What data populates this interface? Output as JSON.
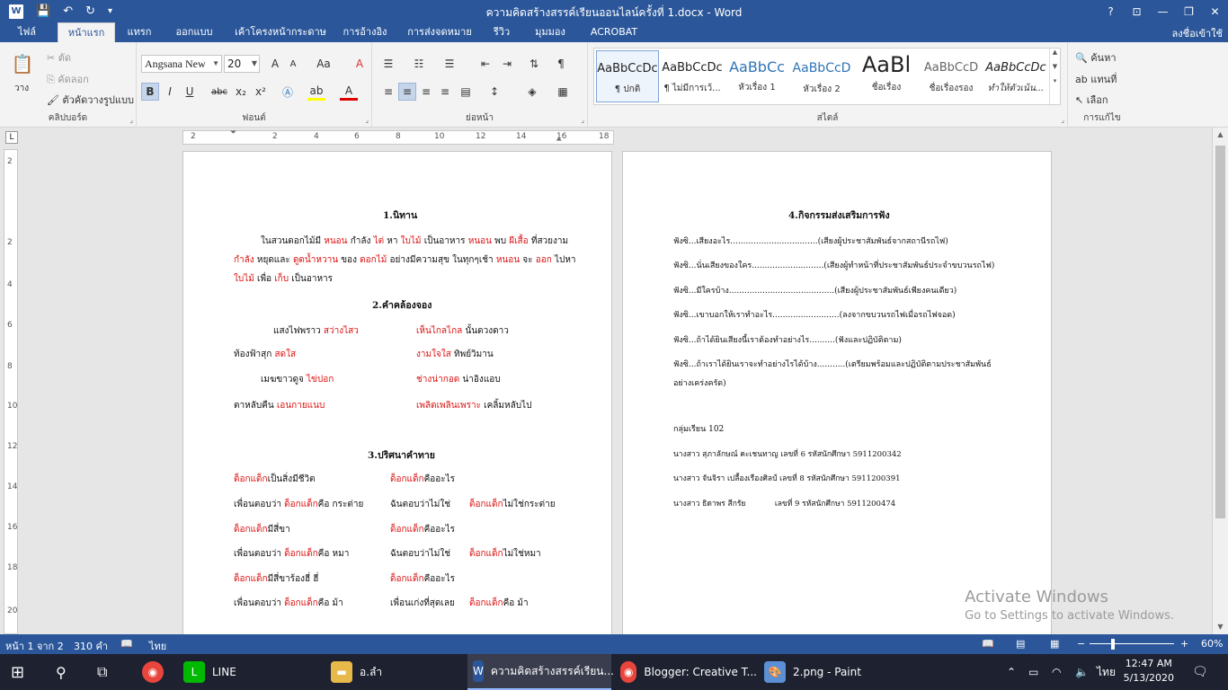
{
  "window": {
    "title": "ความคิดสร้างสรรค์เรียนออนไลน์ครั้งที่ 1.docx - Word",
    "help": "?",
    "controls": [
      "⊡",
      "—",
      "❐",
      "✕"
    ]
  },
  "qat": {
    "word_icon": "W",
    "save": "💾",
    "undo": "↶",
    "redo": "↻",
    "customize": "▾"
  },
  "tabs": {
    "file": "ไฟล์",
    "items": [
      "หน้าแรก",
      "แทรก",
      "ออกแบบ",
      "เค้าโครงหน้ากระดาษ",
      "การอ้างอิง",
      "การส่งจดหมาย",
      "รีวิว",
      "มุมมอง",
      "ACROBAT"
    ],
    "signin": "ลงชื่อเข้าใช้"
  },
  "ribbon": {
    "clipboard": {
      "label": "คลิปบอร์ด",
      "paste": "วาง",
      "cut": "ตัด",
      "copy": "คัดลอก",
      "format_painter": "ตัวคัดวางรูปแบบ"
    },
    "font": {
      "label": "ฟอนต์",
      "font_name": "Angsana New",
      "font_size": "20",
      "bold": "B",
      "italic": "I",
      "underline": "U",
      "strike": "abc",
      "subscript": "x₂",
      "superscript": "x²",
      "grow": "A",
      "shrink": "A",
      "case": "Aa",
      "clear": "A"
    },
    "paragraph": {
      "label": "ย่อหน้า"
    },
    "styles": {
      "label": "สไตล์",
      "items": [
        {
          "preview": "AaBbCcDc",
          "name": "¶ ปกติ"
        },
        {
          "preview": "AaBbCcDc",
          "name": "¶ ไม่มีการเว้..."
        },
        {
          "preview": "AaBbCc",
          "name": "หัวเรื่อง 1"
        },
        {
          "preview": "AaBbCcD",
          "name": "หัวเรื่อง 2"
        },
        {
          "preview": "AaBl",
          "name": "ชื่อเรื่อง"
        },
        {
          "preview": "AaBbCcD",
          "name": "ชื่อเรื่องรอง"
        },
        {
          "preview": "AaBbCcDc",
          "name": "ทำให้ตัวเน้น..."
        }
      ]
    },
    "editing": {
      "label": "การแก้ไข",
      "find": "ค้นหา",
      "replace": "แทนที่",
      "select": "เลือก"
    }
  },
  "hruler": [
    "2",
    "2",
    "4",
    "6",
    "8",
    "10",
    "12",
    "14",
    "16",
    "18"
  ],
  "vruler": [
    "2",
    "2",
    "4",
    "6",
    "8",
    "10",
    "12",
    "14",
    "16",
    "18",
    "20"
  ],
  "page1": {
    "h1": "1.นิทาน",
    "p1_a": "ในสวนดอกไม้มี ",
    "p1_b": "หนอน",
    "p1_c": " กำลัง ",
    "p1_d": "ไต่",
    "p1_e": " หา ",
    "p1_f": "ใบไม้",
    "p1_g": " เป็นอาหาร ",
    "p1_h": "หนอน",
    "p1_i": " พบ ",
    "p1_j": "ผีเสื้อ",
    "p1_k": " ที่สวยงาม",
    "p2_a": "กำลัง",
    "p2_b": " หยุดและ ",
    "p2_c": "ดูดน้ำหวาน",
    "p2_d": " ของ ",
    "p2_e": "ดอกไม้",
    "p2_f": " อย่างมีความสุข ในทุกๆเช้า ",
    "p2_g": "หนอน",
    "p2_h": " จะ ",
    "p2_i": "ออก",
    "p2_j": " ไปหา",
    "p3_a": "ใบไม้",
    "p3_b": " เพื่อ ",
    "p3_c": "เก็บ",
    "p3_d": " เป็นอาหาร",
    "h2": "2.คำคล้องจอง",
    "r1_a": "แสงไฟพราว ",
    "r1_b": "สว่างไสว",
    "r1_c": "เห็นไกลไกล",
    "r1_d": " นั้นดวงดาว",
    "r2_a": "ท้องฟ้าสุก ",
    "r2_b": "สดใส",
    "r2_c": "งามใจใส",
    "r2_d": " ทิพย์วิมาน",
    "r3_a": "เมฆขาวดูจ ",
    "r3_b": "ไข่ปอก",
    "r3_c": "ช่างน่ากอด",
    "r3_d": " น่าอิงแอบ",
    "r4_a": "ตาหลับคืน ",
    "r4_b": "เอนกายแนบ",
    "r4_c": "เพลิดเพลินเพราะ",
    "r4_d": " เคลิ้มหลับไป",
    "h3": "3.ปริศนาคำทาย",
    "q1_a": "ด็อกแด็ก",
    "q1_b": "เป็นสิ่งมีชีวิต",
    "q1_c": "ด็อกแด็ก",
    "q1_d": "คืออะไร",
    "q2_a": "เพื่อนตอบว่า ",
    "q2_b": "ด็อกแด็ก",
    "q2_c": "คือ กระต่าย",
    "q2_d": "ฉันตอบว่าไม่ใช่",
    "q2_e": "ด็อกแด็ก",
    "q2_f": "ไม่ใช่กระต่าย",
    "q3_a": "ด็อกแด็ก",
    "q3_b": "มีสี่ขา",
    "q3_c": "ด็อกแด็ก",
    "q3_d": "คืออะไร",
    "q4_a": "เพื่อนตอบว่า ",
    "q4_b": "ด็อกแด็ก",
    "q4_c": "คือ หมา",
    "q4_d": "ฉันตอบว่าไม่ใช่",
    "q4_e": "ด็อกแด็ก",
    "q4_f": "ไม่ใช่หมา",
    "q5_a": "ด็อกแด็ก",
    "q5_b": "มีสี่ขาร้องฮี่ ฮี่",
    "q5_c": "ด็อกแด็ก",
    "q5_d": "คืออะไร",
    "q6_a": "เพื่อนตอบว่า ",
    "q6_b": "ด็อกแด็ก",
    "q6_c": "คือ ม้า",
    "q6_d": "เพื่อนเก่งที่สุดเลย",
    "q6_e": "ด็อกแด็ก",
    "q6_f": "คือ ม้า"
  },
  "page2": {
    "h4": "4.กิจกรรมส่งเสริมการฟัง",
    "l1": "ฟังซิ...เสียงอะไร..................................(เสียงผู้ประชาสัมพันธ์จากสถานีรถไฟ)",
    "l2": "ฟังซิ...นั่นเสียงของใคร............................(เสียงผู้ทำหน้าที่ประชาสัมพันธ์ประจำขบวนรถไฟ)",
    "l3": "ฟังซิ...มีใครบ้าง.........................................(เสียงผู้ประชาสัมพันธ์เพียงคนเดียว)",
    "l4": "ฟังซิ...เขาบอกให้เราทำอะไร..........................(ลงจากขบวนรถไฟเมื่อรถไฟจอด)",
    "l5": "ฟังซิ...ถ้าได้ยินเสียงนี้เราต้องทำอย่างไร..........(ฟังและปฏิบัติตาม)",
    "l6a": "ฟังซิ...ถ้าเราได้ยินเราจะทำอย่างไรได้บ้าง...........(เตรียมพร้อมและปฏิบัติตามประชาสัมพันธ์",
    "l6b": "อย่างเคร่งครัด)",
    "grp": "กลุ่มเรียน 102",
    "m1": "นางสาว สุภาลักษณ์ คะเชนทาญ เลขที่ 6 รหัสนักศึกษา 5911200342",
    "m2": "นางสาว จันจิรา เปลื้องเรืองศิลป์ เลขที่ 8 รหัสนักศึกษา 5911200391",
    "m3": "นางสาว ธิดาพร สีกรัย            เลขที่ 9 รหัสนักศึกษา 5911200474"
  },
  "activate": {
    "line1": "Activate Windows",
    "line2": "Go to Settings to activate Windows."
  },
  "status": {
    "page": "หน้า 1 จาก 2",
    "words": "310 คำ",
    "lang": "ไทย",
    "zoom": "60%",
    "zoom_minus": "−",
    "zoom_plus": "+"
  },
  "taskbar": {
    "items": [
      {
        "label": "LINE"
      },
      {
        "label": "อ.ลำ"
      },
      {
        "label": "ความคิดสร้างสรรค์เรียน..."
      },
      {
        "label": "Blogger: Creative T..."
      },
      {
        "label": "2.png - Paint"
      }
    ],
    "lang": "ไทย",
    "time": "12:47 AM",
    "date": "5/13/2020"
  },
  "colors": {
    "accent": "#2b579a",
    "red_text": "#dd1111"
  }
}
